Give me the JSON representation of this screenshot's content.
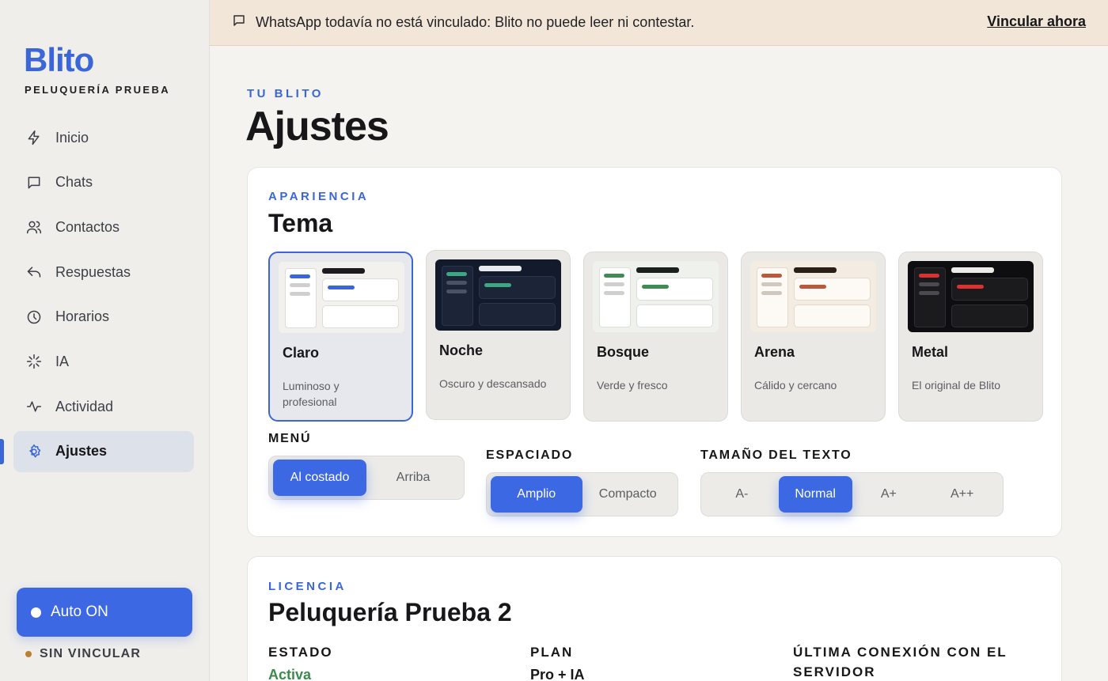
{
  "sidebar": {
    "brand": "Blito",
    "business": "PELUQUERÍA PRUEBA",
    "items": [
      {
        "label": "Inicio",
        "icon": "lightning-icon"
      },
      {
        "label": "Chats",
        "icon": "chat-icon"
      },
      {
        "label": "Contactos",
        "icon": "users-icon"
      },
      {
        "label": "Respuestas",
        "icon": "reply-icon"
      },
      {
        "label": "Horarios",
        "icon": "clock-icon"
      },
      {
        "label": "IA",
        "icon": "sparkle-icon"
      },
      {
        "label": "Actividad",
        "icon": "activity-icon"
      },
      {
        "label": "Ajustes",
        "icon": "gear-icon",
        "active": true
      }
    ],
    "auto_label": "Auto ON",
    "link_status": "SIN VINCULAR"
  },
  "banner": {
    "text": "WhatsApp todavía no está vinculado: Blito no puede leer ni contestar.",
    "link": "Vincular ahora"
  },
  "page": {
    "eyebrow": "TU BLITO",
    "title": "Ajustes"
  },
  "appearance": {
    "eyebrow": "APARIENCIA",
    "title": "Tema",
    "themes": [
      {
        "name": "Claro",
        "desc": "Luminoso y profesional",
        "selected": true,
        "accent": "#3a66d8"
      },
      {
        "name": "Noche",
        "desc": "Oscuro y descansado",
        "accent": "#3fa683"
      },
      {
        "name": "Bosque",
        "desc": "Verde y fresco",
        "accent": "#3f8a55"
      },
      {
        "name": "Arena",
        "desc": "Cálido y cercano",
        "accent": "#b9583a"
      },
      {
        "name": "Metal",
        "desc": "El original de Blito",
        "accent": "#d83232"
      }
    ],
    "menu": {
      "label": "MENÚ",
      "options": [
        "Al costado",
        "Arriba"
      ],
      "selected": "Al costado"
    },
    "spacing": {
      "label": "ESPACIADO",
      "options": [
        "Amplio",
        "Compacto"
      ],
      "selected": "Amplio"
    },
    "text_size": {
      "label": "TAMAÑO DEL TEXTO",
      "options": [
        "A-",
        "Normal",
        "A+",
        "A++"
      ],
      "selected": "Normal"
    }
  },
  "license": {
    "eyebrow": "LICENCIA",
    "title": "Peluquería Prueba 2",
    "fields": [
      {
        "label": "ESTADO",
        "value": "Activa",
        "color": "#3d8a4a"
      },
      {
        "label": "PLAN",
        "value": "Pro + IA",
        "color": "#17171a"
      },
      {
        "label": "ÚLTIMA CONEXIÓN CON EL SERVIDOR",
        "value": "",
        "color": "#17171a"
      }
    ]
  },
  "colors": {
    "accent": "#3d68e3",
    "banner_bg": "#f1e6d8",
    "status_unlinked": "#b98032"
  }
}
